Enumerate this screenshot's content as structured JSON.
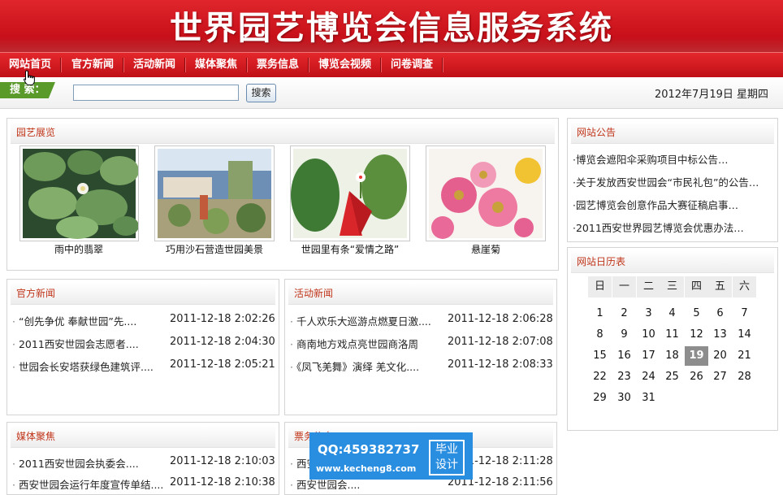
{
  "header": {
    "title": "世界园艺博览会信息服务系统"
  },
  "nav": {
    "items": [
      "网站首页",
      "官方新闻",
      "活动新闻",
      "媒体聚焦",
      "票务信息",
      "博览会视频",
      "问卷调查"
    ]
  },
  "search": {
    "label": "搜 索：",
    "value": "",
    "button": "搜索"
  },
  "date": "2012年7月19日 星期四",
  "gallery": {
    "title": "园艺展览",
    "items": [
      {
        "caption": "雨中的翡翠"
      },
      {
        "caption": "巧用沙石营造世园美景"
      },
      {
        "caption": "世园里有条“爱情之路”"
      },
      {
        "caption": "悬崖菊"
      }
    ]
  },
  "official": {
    "title": "官方新闻",
    "rows": [
      {
        "text": "“创先争优 奉献世园”先....",
        "time": "2011-12-18 2:02:26"
      },
      {
        "text": "2011西安世园会志愿者....",
        "time": "2011-12-18 2:04:30"
      },
      {
        "text": "世园会长安塔获绿色建筑评....",
        "time": "2011-12-18 2:05:21"
      }
    ]
  },
  "activity": {
    "title": "活动新闻",
    "rows": [
      {
        "text": "千人欢乐大巡游点燃夏日激....",
        "time": "2011-12-18 2:06:28"
      },
      {
        "text": "商南地方戏点亮世园商洛周",
        "time": "2011-12-18 2:07:08"
      },
      {
        "text": "《凤飞羌舞》演绎 羌文化....",
        "time": "2011-12-18 2:08:33"
      }
    ]
  },
  "media": {
    "title": "媒体聚焦",
    "rows": [
      {
        "text": "2011西安世园会执委会....",
        "time": "2011-12-18 2:10:03"
      },
      {
        "text": "西安世园会运行年度宣传单结....",
        "time": "2011-12-18 2:10:38"
      }
    ]
  },
  "tickets": {
    "title": "票务信息",
    "rows": [
      {
        "text": "西安世园会....",
        "time": "2011-12-18 2:11:28"
      },
      {
        "text": "西安世园会....",
        "time": "2011-12-18 2:11:56"
      }
    ]
  },
  "notices": {
    "title": "网站公告",
    "items": [
      "博览会遮阳伞采购项目中标公告…",
      "关于发放西安世园会“市民礼包”的公告…",
      "园艺博览会创意作品大赛征稿启事…",
      "2011西安世界园艺博览会优惠办法…"
    ]
  },
  "calendar": {
    "title": "网站日历表",
    "weekdays": [
      "日",
      "一",
      "二",
      "三",
      "四",
      "五",
      "六"
    ],
    "weeks": [
      [
        "1",
        "2",
        "3",
        "4",
        "5",
        "6",
        "7"
      ],
      [
        "8",
        "9",
        "10",
        "11",
        "12",
        "13",
        "14"
      ],
      [
        "15",
        "16",
        "17",
        "18",
        "19",
        "20",
        "21"
      ],
      [
        "22",
        "23",
        "24",
        "25",
        "26",
        "27",
        "28"
      ],
      [
        "29",
        "30",
        "31",
        "",
        "",
        "",
        ""
      ]
    ],
    "today": "19"
  },
  "watermark": {
    "qq": "QQ:459382737",
    "url": "www.kecheng8.com",
    "tag_line1": "毕业",
    "tag_line2": "设计"
  },
  "colors": {
    "brand_red": "#c8101a",
    "section_title": "#c0351a",
    "search_green": "#5a9a2a",
    "watermark_blue": "#2a8ee0"
  }
}
